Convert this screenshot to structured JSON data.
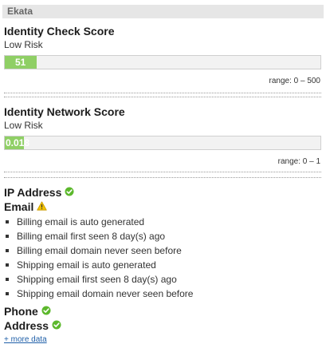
{
  "panel": {
    "title": "Ekata"
  },
  "identity_check": {
    "title": "Identity Check Score",
    "risk": "Low Risk",
    "score_label": "51",
    "score_value": 51,
    "range": "range: 0 – 500",
    "range_max": 500,
    "bar_color": "#8fcf65"
  },
  "identity_network": {
    "title": "Identity Network Score",
    "risk": "Low Risk",
    "score_label": "0.018",
    "score_value": 0.018,
    "range": "range: 0 – 1",
    "range_max": 1,
    "bar_color": "#8fcf65"
  },
  "ip_address": {
    "title": "IP Address",
    "status_icon": "check-icon",
    "status_color": "#5cb82c"
  },
  "email": {
    "title": "Email",
    "status_icon": "warning-icon",
    "status_color": "#f2c200",
    "alerts": [
      "Billing email is auto generated",
      "Billing email first seen 8 day(s) ago",
      "Billing email domain never seen before",
      "Shipping email is auto generated",
      "Shipping email first seen 8 day(s) ago",
      "Shipping email domain never seen before"
    ]
  },
  "phone": {
    "title": "Phone",
    "status_icon": "check-icon",
    "status_color": "#5cb82c"
  },
  "address": {
    "title": "Address",
    "status_icon": "check-icon",
    "status_color": "#5cb82c"
  },
  "more_data_link": "+ more data"
}
